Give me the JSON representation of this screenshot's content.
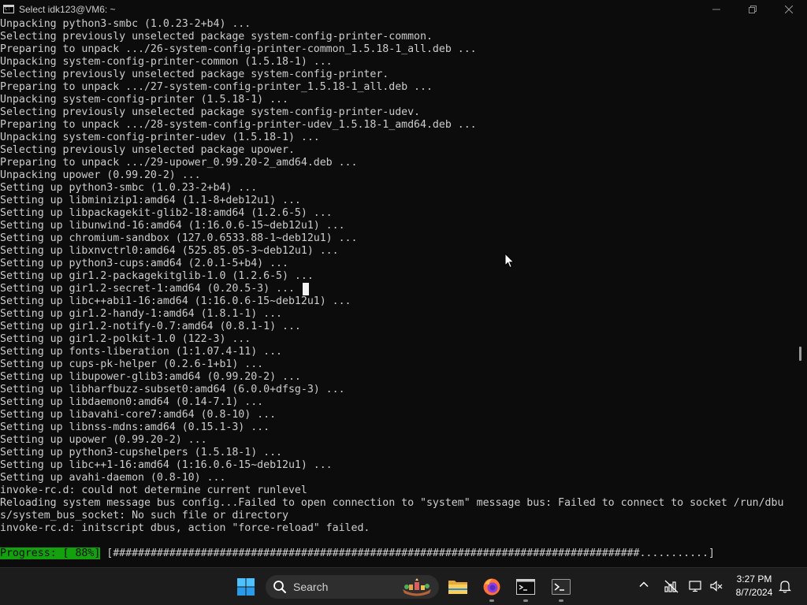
{
  "window": {
    "title": "Select idk123@VM6: ~",
    "icon": "console-icon",
    "controls": [
      "minimize-icon",
      "maximize-icon",
      "close-icon"
    ]
  },
  "terminal": {
    "lines": [
      "Unpacking python3-smbc (1.0.23-2+b4) ...",
      "Selecting previously unselected package system-config-printer-common.",
      "Preparing to unpack .../26-system-config-printer-common_1.5.18-1_all.deb ...",
      "Unpacking system-config-printer-common (1.5.18-1) ...",
      "Selecting previously unselected package system-config-printer.",
      "Preparing to unpack .../27-system-config-printer_1.5.18-1_all.deb ...",
      "Unpacking system-config-printer (1.5.18-1) ...",
      "Selecting previously unselected package system-config-printer-udev.",
      "Preparing to unpack .../28-system-config-printer-udev_1.5.18-1_amd64.deb ...",
      "Unpacking system-config-printer-udev (1.5.18-1) ...",
      "Selecting previously unselected package upower.",
      "Preparing to unpack .../29-upower_0.99.20-2_amd64.deb ...",
      "Unpacking upower (0.99.20-2) ...",
      "Setting up python3-smbc (1.0.23-2+b4) ...",
      "Setting up libminizip1:amd64 (1.1-8+deb12u1) ...",
      "Setting up libpackagekit-glib2-18:amd64 (1.2.6-5) ...",
      "Setting up libunwind-16:amd64 (1:16.0.6-15~deb12u1) ...",
      "Setting up chromium-sandbox (127.0.6533.88-1~deb12u1) ...",
      "Setting up libxnvctrl0:amd64 (525.85.05-3~deb12u1) ...",
      "Setting up python3-cups:amd64 (2.0.1-5+b4) ...",
      "Setting up gir1.2-packagekitglib-1.0 (1.2.6-5) ...",
      "Setting up gir1.2-secret-1:amd64 (0.20.5-3) ...",
      "Setting up libc++abi1-16:amd64 (1:16.0.6-15~deb12u1) ...",
      "Setting up gir1.2-handy-1:amd64 (1.8.1-1) ...",
      "Setting up gir1.2-notify-0.7:amd64 (0.8.1-1) ...",
      "Setting up gir1.2-polkit-1.0 (122-3) ...",
      "Setting up fonts-liberation (1:1.07.4-11) ...",
      "Setting up cups-pk-helper (0.2.6-1+b1) ...",
      "Setting up libupower-glib3:amd64 (0.99.20-2) ...",
      "Setting up libharfbuzz-subset0:amd64 (6.0.0+dfsg-3) ...",
      "Setting up libdaemon0:amd64 (0.14-7.1) ...",
      "Setting up libavahi-core7:amd64 (0.8-10) ...",
      "Setting up libnss-mdns:amd64 (0.15.1-3) ...",
      "Setting up upower (0.99.20-2) ...",
      "Setting up python3-cupshelpers (1.5.18-1) ...",
      "Setting up libc++1-16:amd64 (1:16.0.6-15~deb12u1) ...",
      "Setting up avahi-daemon (0.8-10) ...",
      "invoke-rc.d: could not determine current runlevel",
      "Reloading system message bus config...Failed to open connection to \"system\" message bus: Failed to connect to socket /run/dbu",
      "s/system_bus_socket: No such file or directory",
      "invoke-rc.d: initscript dbus, action \"force-reload\" failed."
    ],
    "progress_label": "Progress: [ 88%]",
    "progress_bar": " [####################################################################################...........]",
    "progress_percent": 88
  },
  "taskbar": {
    "start_icon": "windows-start-icon",
    "search_placeholder": "Search",
    "pinned": [
      {
        "name": "file-explorer-icon",
        "running": false
      },
      {
        "name": "firefox-icon",
        "running": true
      },
      {
        "name": "command-prompt-icon",
        "running": true
      },
      {
        "name": "powershell-icon",
        "running": true
      }
    ],
    "tray_icons": [
      "chevron-up-icon",
      "network-off-icon",
      "display-icon",
      "volume-muted-icon",
      "notification-bell-icon"
    ],
    "time": "3:27 PM",
    "date": "8/7/2024"
  },
  "colors": {
    "terminal_bg": "#0c0c0c",
    "terminal_fg": "#cccccc",
    "progress_bg": "#13a10e",
    "taskbar_bg": "#1c1c1c",
    "accent": "#0078d4"
  }
}
